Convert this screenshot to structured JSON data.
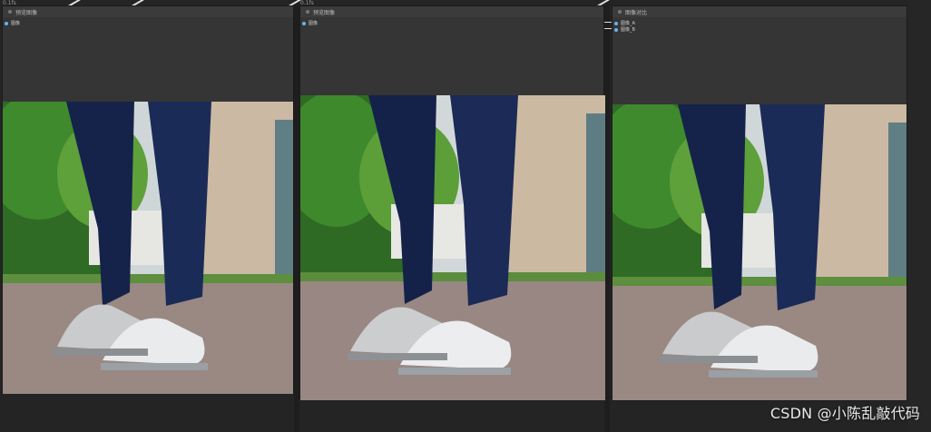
{
  "nodes": [
    {
      "badge": "0.1fs",
      "title": "预览图像",
      "slots": [
        "图像"
      ]
    },
    {
      "badge": "0.1fs",
      "title": "预览图像",
      "slots": [
        "图像"
      ]
    },
    {
      "badge": "",
      "title": "图像对比",
      "slots": [
        "图像_A",
        "图像_B"
      ]
    }
  ],
  "watermark": "CSDN @小陈乱敲代码",
  "colors": {
    "canvas": "#242424",
    "node": "#353535",
    "pin": "#64b5f6"
  }
}
